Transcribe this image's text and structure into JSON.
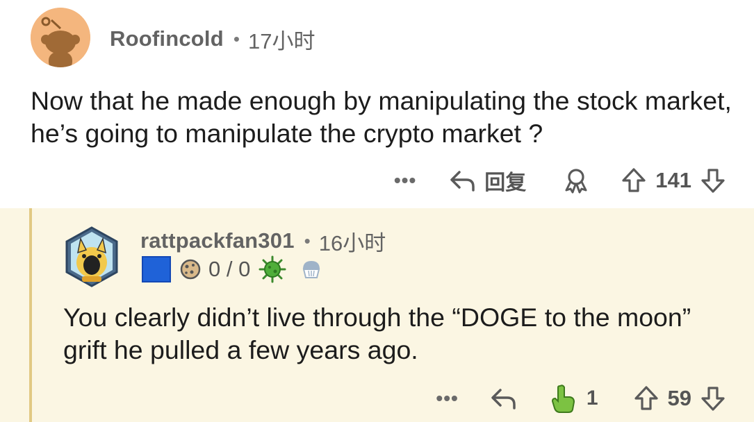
{
  "comment": {
    "username": "Roofincold",
    "separator": "•",
    "time": "17小时",
    "text": "Now that he made enough by manipulating the stock market, he’s going to manipulate the crypto market ?",
    "actions": {
      "more": "•••",
      "reply_label": "回复",
      "score": "141"
    },
    "avatar_color": "#f4b67e"
  },
  "reply": {
    "username": "rattpackfan301",
    "separator": "•",
    "time": "16小时",
    "flair_text": "0 / 0",
    "text": "You clearly didn’t live through the “DOGE to the moon” grift he pulled a few years ago.",
    "actions": {
      "more": "•••",
      "award_count": "1",
      "score": "59"
    },
    "background": "#fbf6e3",
    "thread_line_color": "#e1c983"
  },
  "icons": [
    "snoo-avatar-icon",
    "reply-arrow-icon",
    "award-icon",
    "upvote-icon",
    "downvote-icon",
    "pointing-hand-icon",
    "cookie-icon",
    "virus-icon",
    "cupcake-icon"
  ]
}
